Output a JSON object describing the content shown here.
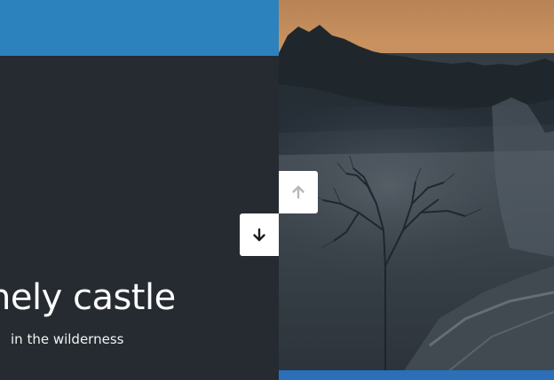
{
  "slide": {
    "title": "nely castle",
    "subtitle": "in the wilderness"
  },
  "controls": {
    "up_icon": "arrow-up-icon",
    "down_icon": "arrow-down-icon"
  },
  "colors": {
    "top_bar": "#2b82bd",
    "left_background": "#252b31",
    "bottom_bar": "#2a6fb8",
    "button_background": "#ffffff",
    "up_arrow_disabled": "#b8b8b8",
    "down_arrow": "#1c1c1c"
  }
}
